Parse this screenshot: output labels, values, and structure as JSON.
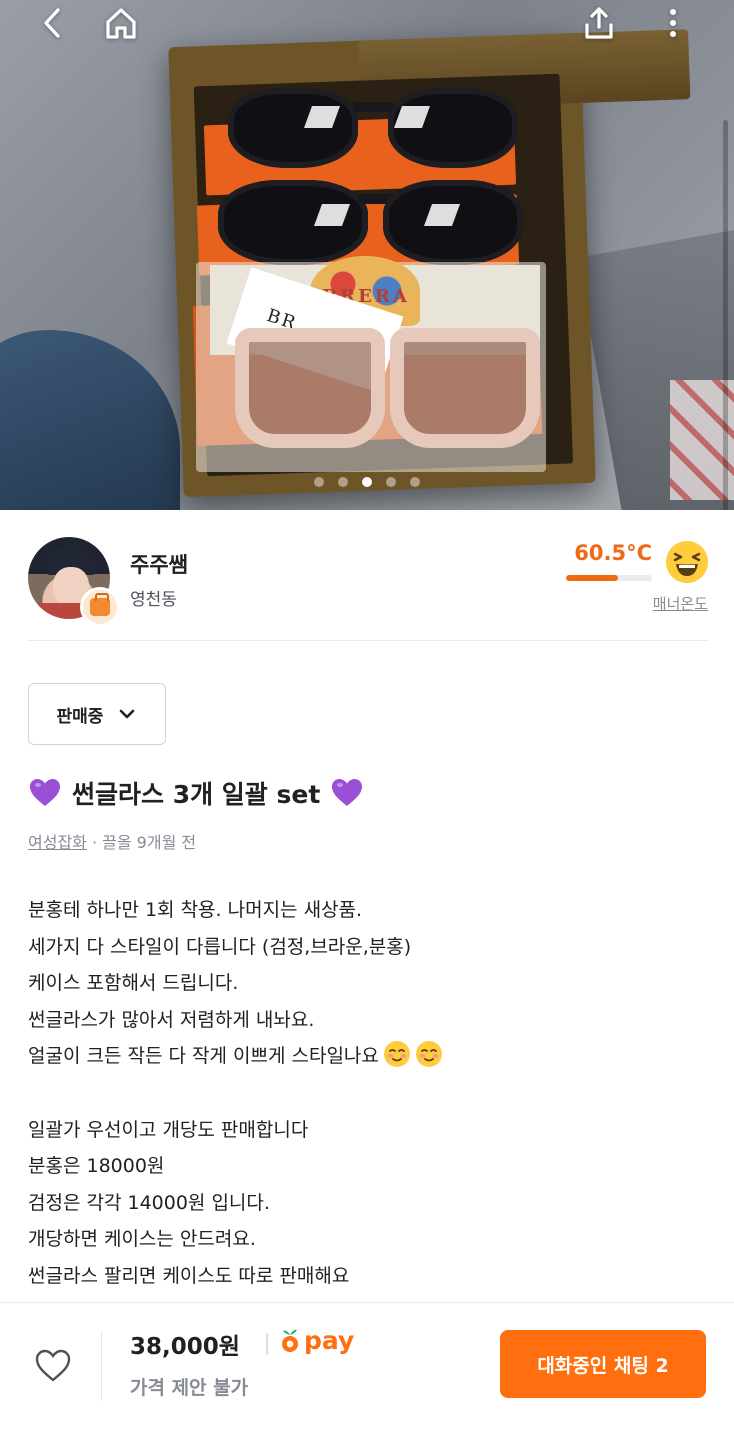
{
  "header": {
    "icons": [
      "back-arrow-icon",
      "home-icon",
      "share-icon",
      "more-vertical-icon"
    ]
  },
  "gallery": {
    "image_count": 5,
    "active_index": 2,
    "print_brand": "BRERA",
    "card_text": "BR"
  },
  "seller": {
    "name": "주주쌤",
    "location": "영천동",
    "temperature": "60.5°C",
    "temperature_fill": 0.605,
    "manner_label": "매너온도",
    "accent_color": "#ef6b13"
  },
  "status_dropdown": {
    "selected": "판매중"
  },
  "post": {
    "title": "썬글라스 3개 일괄 set",
    "category": "여성잡화",
    "meta_sep": " · ",
    "time": "끌올 9개월 전",
    "description": [
      "분홍테 하나만 1회 착용. 나머지는 새상품.",
      "세가지 다 스타일이 다릅니다 (검정,브라운,분홍)",
      "케이스 포함해서 드립니다.",
      "썬글라스가 많아서 저렴하게 내놔요.",
      "얼굴이 크든 작든 다 작게 이쁘게 스타일나요",
      "",
      "일괄가 우선이고 개당도 판매합니다",
      "분홍은 18000원",
      "검정은 각각 14000원 입니다.",
      "개당하면 케이스는 안드려요.",
      "썬글라스 팔리면 케이스도 따로 판매해요"
    ]
  },
  "bottom_bar": {
    "price": "38,000원",
    "pay_label": "pay",
    "negotiation": "가격 제안 불가",
    "chat_button": "대화중인 채팅 2",
    "brand_color": "#ff6f0f"
  }
}
